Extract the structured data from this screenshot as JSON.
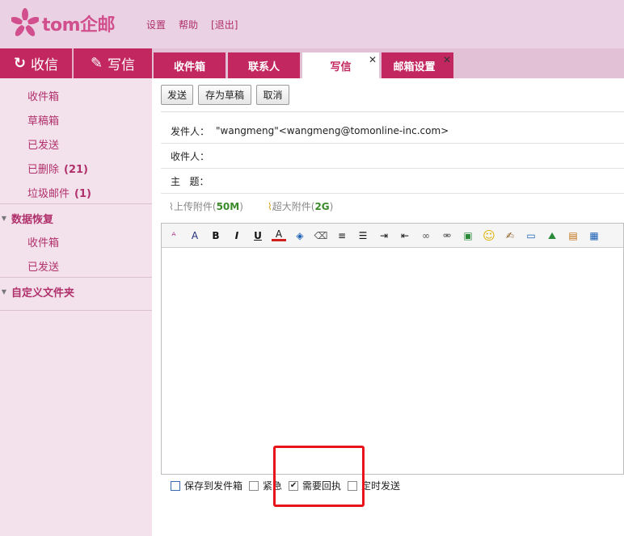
{
  "brand": {
    "name": "tom企邮",
    "accent": "#c2285f",
    "logo_icon": "flower-logo-icon"
  },
  "top_links": [
    "设置",
    "帮助",
    "[退出]"
  ],
  "actions": {
    "receive": "收信",
    "compose": "写信",
    "receive_icon": "refresh-icon",
    "compose_icon": "edit-icon"
  },
  "tabs": [
    {
      "label": "收件箱",
      "active": false,
      "closable": false
    },
    {
      "label": "联系人",
      "active": false,
      "closable": false
    },
    {
      "label": "写信",
      "active": true,
      "closable": true
    },
    {
      "label": "邮箱设置",
      "active": false,
      "closable": true
    }
  ],
  "sidebar": {
    "folders": [
      {
        "label": "收件箱",
        "count": ""
      },
      {
        "label": "草稿箱",
        "count": ""
      },
      {
        "label": "已发送",
        "count": ""
      },
      {
        "label": "已删除",
        "count": "(21)"
      },
      {
        "label": "垃圾邮件",
        "count": "(1)"
      }
    ],
    "recovery": {
      "title": "数据恢复",
      "items": [
        "收件箱",
        "已发送"
      ]
    },
    "custom": {
      "title": "自定义文件夹"
    }
  },
  "compose": {
    "buttons": {
      "send": "发送",
      "save_draft": "存为草稿",
      "cancel": "取消"
    },
    "from_label": "发件人：",
    "from_value": "\"wangmeng\"<wangmeng@tomonline-inc.com>",
    "to_label": "收件人：",
    "subject_label": "主   题：",
    "attach": {
      "upload": "上传附件",
      "upload_size": "50M",
      "large": "超大附件",
      "large_size": "2G"
    }
  },
  "editor_icons": [
    "font-family-icon",
    "font-size-icon",
    "bold-icon",
    "italic-icon",
    "underline-icon",
    "font-color-icon",
    "highlight-color-icon",
    "eraser-icon",
    "align-icon",
    "bulleted-list-icon",
    "indent-icon",
    "outdent-icon",
    "link-icon",
    "unlink-icon",
    "image-icon",
    "emoji-icon",
    "signature-icon",
    "window-icon",
    "insert-picture-icon",
    "stationery-icon",
    "card-icon"
  ],
  "options": [
    {
      "label": "保存到发件箱",
      "checked": false
    },
    {
      "label": "紧急",
      "checked": false
    },
    {
      "label": "需要回执",
      "checked": true
    },
    {
      "label": "定时发送",
      "checked": false
    }
  ]
}
